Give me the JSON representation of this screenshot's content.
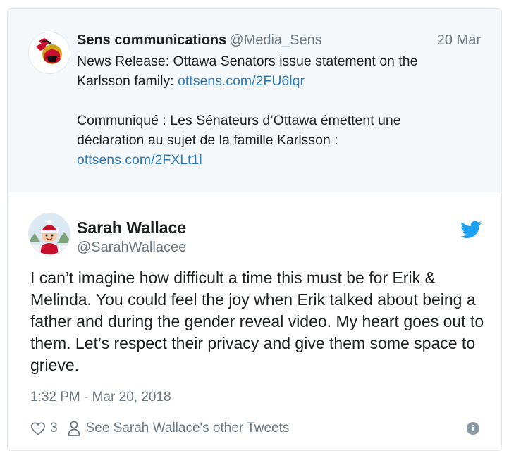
{
  "quoted_tweet": {
    "author_name": "Sens communications",
    "author_handle": "@Media_Sens",
    "date": "20 Mar",
    "paragraph1_text": "News Release: Ottawa Senators issue statement on the Karlsson family: ",
    "paragraph1_link": "ottsens.com/2FU6lqr",
    "paragraph2_text": "Communiqué : Les Sénateurs d’Ottawa émettent une déclaration au sujet de la famille Karlsson : ",
    "paragraph2_link": "ottsens.com/2FXLt1l",
    "avatar_icon": "senators-logo-icon"
  },
  "tweet": {
    "author_name": "Sarah Wallace",
    "author_handle": "@SarahWallacee",
    "avatar_icon": "bitmoji-avatar-icon",
    "text": "I can’t imagine how difficult a time this must be for Erik & Melinda. You could feel the joy when Erik talked about being a father and during the gender reveal video. My heart goes out to them. Let’s respect their privacy and give them some space to grieve.",
    "timestamp": "1:32 PM - Mar 20, 2018",
    "like_count": "3",
    "profile_link": "See Sarah Wallace's other Tweets",
    "info_symbol": "i"
  },
  "icons": {
    "brand": "twitter-bird-icon",
    "like": "heart-outline-icon",
    "profile": "person-icon",
    "info": "info-icon"
  },
  "colors": {
    "link": "#2b7bb9",
    "twitter_blue": "#1da1f2",
    "muted_text": "#697882",
    "quoted_bg": "#f5f8fa",
    "border": "#e1e8ed"
  }
}
